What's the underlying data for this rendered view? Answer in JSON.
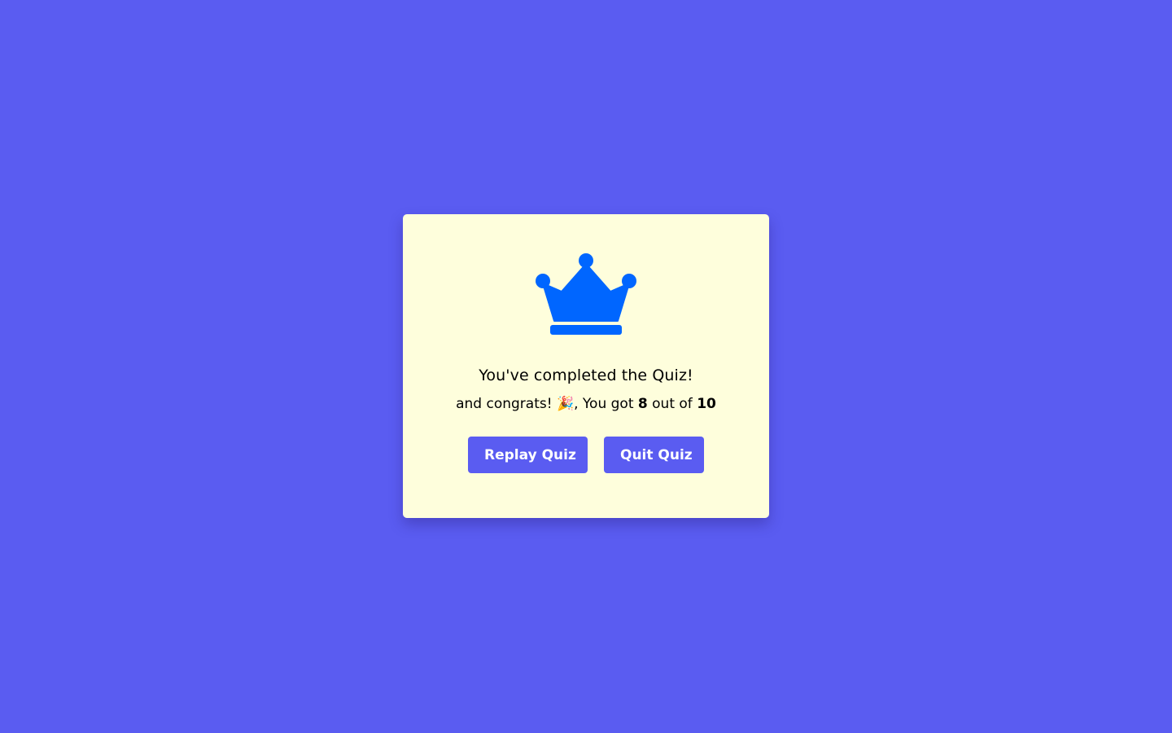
{
  "result": {
    "crown_icon": "crown-icon",
    "crown_color": "#0066ff",
    "complete_text": "You've completed the Quiz!",
    "score_prefix": "and congrats! 🎉, You got",
    "score_value": "8",
    "score_middle": "out of",
    "score_total": "10",
    "replay_label": "Replay Quiz",
    "quit_label": "Quit Quiz"
  },
  "colors": {
    "background": "#5a5cf1",
    "card": "#fefedc",
    "button": "#5a5cf1"
  }
}
